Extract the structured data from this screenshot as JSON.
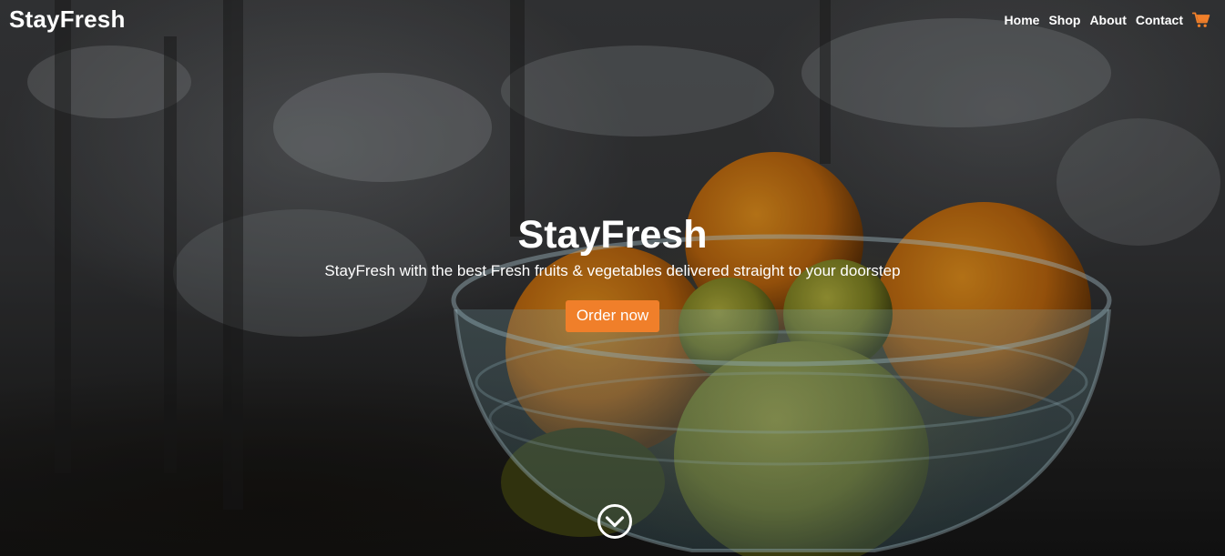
{
  "navbar": {
    "brand": "StayFresh",
    "links": [
      {
        "label": "Home"
      },
      {
        "label": "Shop"
      },
      {
        "label": "About"
      },
      {
        "label": "Contact"
      }
    ],
    "cart_icon": "shopping-cart-icon",
    "cart_color": "#f07f2a"
  },
  "hero": {
    "title": "StayFresh",
    "subtitle": "StayFresh with the best Fresh fruits & vegetables delivered straight to your doorstep",
    "cta_label": "Order now",
    "cta_color": "#f07f2a",
    "scroll_icon": "chevron-down-circle-icon"
  }
}
